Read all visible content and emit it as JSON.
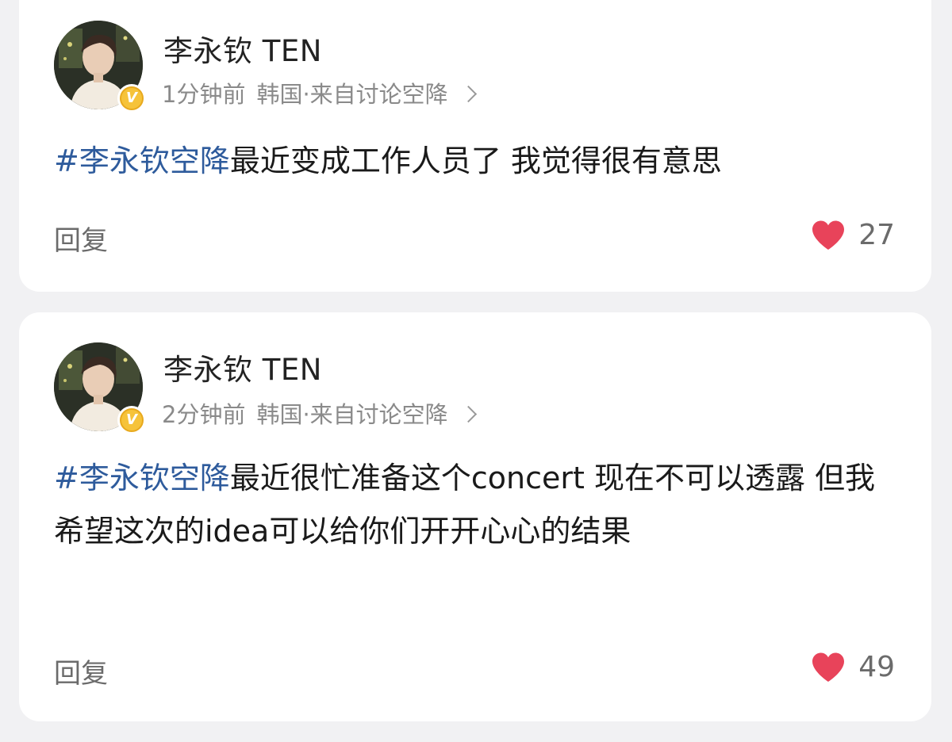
{
  "posts": [
    {
      "username": "李永钦 TEN",
      "time": "1分钟前",
      "location": "韩国·来自讨论空降",
      "hashtag": "#李永钦空降",
      "text": "最近变成工作人员了 我觉得很有意思",
      "reply_label": "回复",
      "like_count": "27"
    },
    {
      "username": "李永钦 TEN",
      "time": "2分钟前",
      "location": "韩国·来自讨论空降",
      "hashtag": "#李永钦空降",
      "text": "最近很忙准备这个concert 现在不可以透露 但我希望这次的idea可以给你们开开心心的结果",
      "reply_label": "回复",
      "like_count": "49"
    }
  ],
  "badge": {
    "letter": "V",
    "color": "#f6c33a"
  },
  "colors": {
    "hashtag": "#2e5b9c",
    "heart": "#e8435a",
    "meta": "#8a8a8a"
  },
  "icons": {
    "heart": "heart-icon",
    "badge": "verified-badge-icon",
    "chevron": "chevron-right-icon"
  }
}
